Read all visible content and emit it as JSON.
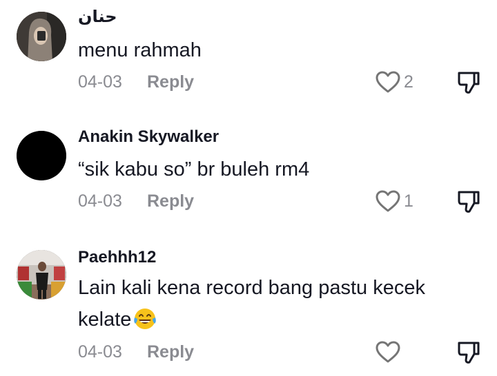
{
  "comments": [
    {
      "username": "حنان",
      "text": "menu rahmah",
      "date": "04-03",
      "reply_label": "Reply",
      "likes": "2",
      "avatar_icon": "profile-photo-woman-hijab"
    },
    {
      "username": "Anakin Skywalker",
      "text": "“sik kabu so” br buleh rm4",
      "date": "04-03",
      "reply_label": "Reply",
      "likes": "1",
      "avatar_icon": "profile-photo-black"
    },
    {
      "username": "Paehhh12",
      "text": "Lain kali kena record bang pastu kecek kelate",
      "emoji": "face-with-tears-of-joy",
      "date": "04-03",
      "reply_label": "Reply",
      "likes": "",
      "avatar_icon": "profile-photo-person-store"
    }
  ],
  "icons": {
    "like": "heart-outline-icon",
    "dislike": "thumbs-down-outline-icon"
  },
  "colors": {
    "text": "#161823",
    "meta": "#8a8b91"
  }
}
